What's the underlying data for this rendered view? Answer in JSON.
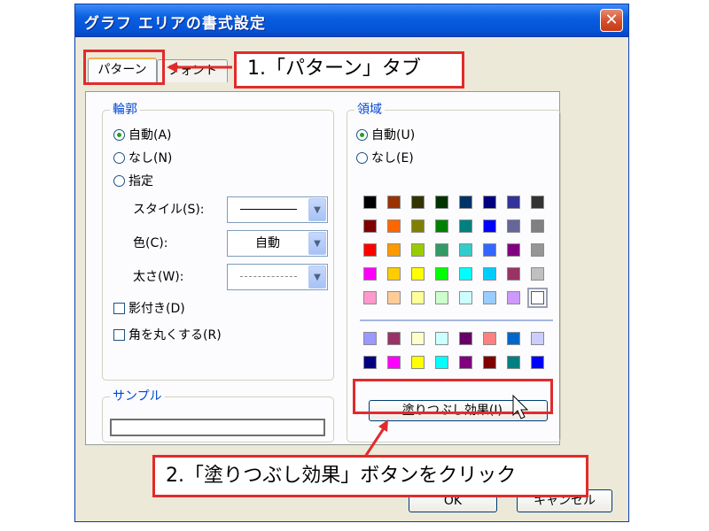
{
  "window": {
    "title": "グラフ エリアの書式設定",
    "close_symbol": "✕"
  },
  "tabs": [
    {
      "label": "パターン",
      "active": true
    },
    {
      "label": "フォント",
      "active": false
    }
  ],
  "border_group": {
    "title": "輪郭",
    "radios": [
      {
        "label": "自動(A)",
        "checked": true
      },
      {
        "label": "なし(N)",
        "checked": false
      },
      {
        "label": "指定",
        "checked": false
      }
    ],
    "style_label": "スタイル(S):",
    "color_label": "色(C):",
    "color_value": "自動",
    "weight_label": "太さ(W):",
    "checkboxes": [
      {
        "label": "影付き(D)",
        "checked": false
      },
      {
        "label": "角を丸くする(R)",
        "checked": false
      }
    ]
  },
  "sample_group": {
    "title": "サンプル"
  },
  "area_group": {
    "title": "領域",
    "radios": [
      {
        "label": "自動(U)",
        "checked": true
      },
      {
        "label": "なし(E)",
        "checked": false
      }
    ],
    "palette_colors": [
      "#000000",
      "#993300",
      "#333300",
      "#003300",
      "#003366",
      "#000080",
      "#333399",
      "#333333",
      "#800000",
      "#ff6600",
      "#808000",
      "#008000",
      "#008080",
      "#0000ff",
      "#666699",
      "#808080",
      "#ff0000",
      "#ff9900",
      "#99cc00",
      "#339966",
      "#33cccc",
      "#3366ff",
      "#800080",
      "#969696",
      "#ff00ff",
      "#ffcc00",
      "#ffff00",
      "#00ff00",
      "#00ffff",
      "#00ccff",
      "#993366",
      "#c0c0c0",
      "#ff99cc",
      "#ffcc99",
      "#ffff99",
      "#ccffcc",
      "#ccffff",
      "#99ccff",
      "#cc99ff",
      "#ffffff"
    ],
    "extra_colors": [
      "#9999ff",
      "#993366",
      "#ffffcc",
      "#ccffff",
      "#660066",
      "#ff8080",
      "#0066cc",
      "#ccccff",
      "#000080",
      "#ff00ff",
      "#ffff00",
      "#00ffff",
      "#800080",
      "#800000",
      "#008080",
      "#0000ff"
    ],
    "fill_effects_label": "塗りつぶし効果(I)..."
  },
  "footer_buttons": {
    "ok": "OK",
    "cancel": "キャンセル"
  },
  "annotations": {
    "tab_note": "1.「パターン」タブ",
    "button_note": "2.「塗りつぶし効果」ボタンをクリック",
    "color": "#e12b2b"
  }
}
